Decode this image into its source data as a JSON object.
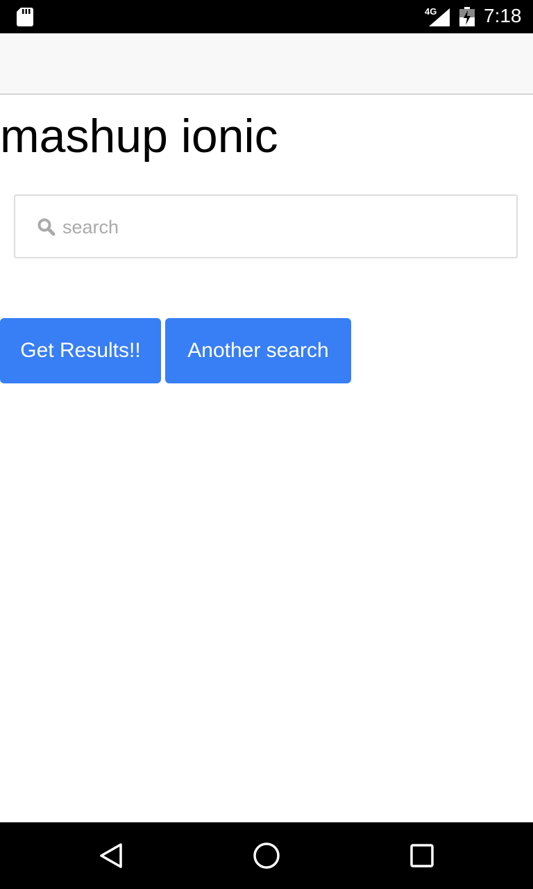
{
  "status_bar": {
    "network": "4G",
    "time": "7:18",
    "icons": [
      "sd-card-icon",
      "signal-icon",
      "battery-icon"
    ]
  },
  "header": {
    "title": ""
  },
  "main": {
    "title": "mashup ionic",
    "search": {
      "placeholder": "search",
      "value": "",
      "icon": "search-icon"
    },
    "buttons": {
      "get_results": "Get Results!!",
      "another_search": "Another search"
    }
  },
  "nav_bar": {
    "icons": [
      "back-icon",
      "home-icon",
      "recents-icon"
    ]
  },
  "colors": {
    "button_bg": "#387ef5",
    "header_bg": "#f8f8f8",
    "status_bg": "#000000"
  }
}
